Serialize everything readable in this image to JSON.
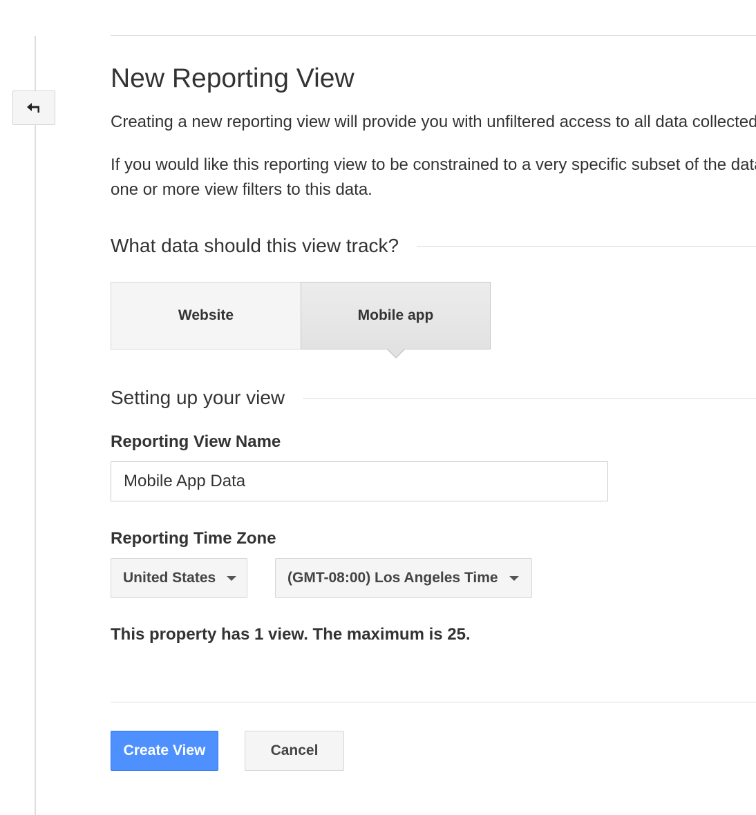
{
  "header": {
    "back_icon": "back-arrow-icon",
    "title": "New Reporting View",
    "intro_text": "Creating a new reporting view will provide you with unfiltered access to all data collected",
    "filter_text_line1": "If you would like this reporting view to be constrained to a very specific subset of the data, you can apply",
    "filter_text_line2": "one or more view filters to this data."
  },
  "track_section": {
    "heading": "What data should this view track?",
    "options": [
      {
        "label": "Website",
        "selected": false
      },
      {
        "label": "Mobile app",
        "selected": true
      }
    ]
  },
  "setup_section": {
    "heading": "Setting up your view",
    "view_name": {
      "label": "Reporting View Name",
      "value": "Mobile App Data"
    },
    "time_zone": {
      "label": "Reporting Time Zone",
      "country": "United States",
      "zone": "(GMT-08:00) Los Angeles Time"
    }
  },
  "note": "This property has 1 view. The maximum is 25.",
  "actions": {
    "create_label": "Create View",
    "cancel_label": "Cancel"
  },
  "colors": {
    "primary_button": "#4d90fe",
    "rule": "#dddddd",
    "text": "#333333"
  }
}
